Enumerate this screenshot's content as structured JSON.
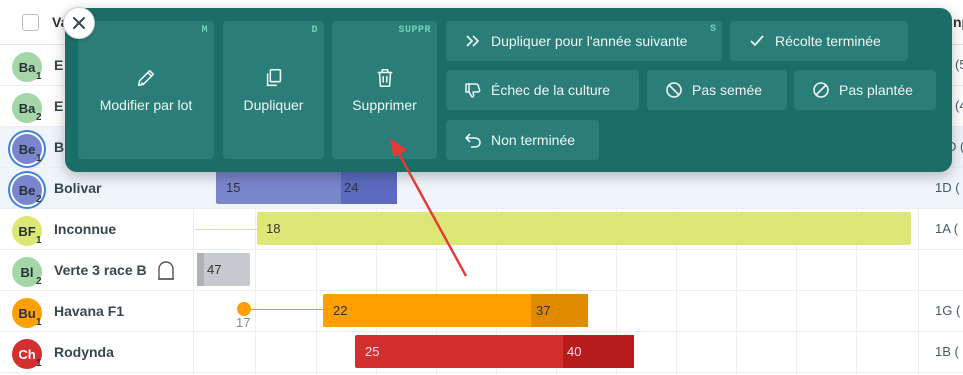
{
  "header": {
    "name_col_label": "Va",
    "right_col_label": "np"
  },
  "rows": [
    {
      "avatar": "Ba",
      "sub": "1",
      "name": "E",
      "color": "#a5d6a7",
      "right": "(5"
    },
    {
      "avatar": "Ba",
      "sub": "2",
      "name": "E",
      "color": "#a5d6a7",
      "right": "(4"
    },
    {
      "avatar": "Be",
      "sub": "1",
      "name": "B",
      "color": "#7986cb",
      "right": "D ("
    },
    {
      "avatar": "Be",
      "sub": "2",
      "name": "Bolivar",
      "color": "#7986cb",
      "right": "1D ("
    },
    {
      "avatar": "BF",
      "sub": "1",
      "name": "Inconnue",
      "color": "#dce775",
      "right": "1A ("
    },
    {
      "avatar": "Bl",
      "sub": "2",
      "name": "Verte 3 race B",
      "color": "#a5d6a7",
      "right": ""
    },
    {
      "avatar": "Bu",
      "sub": "1",
      "name": "Havana F1",
      "color": "#ffa000",
      "right": "1G ("
    },
    {
      "avatar": "Ch",
      "sub": "1",
      "name": "Rodynda",
      "color": "#d32f2f",
      "right": "1B ("
    }
  ],
  "bars": {
    "bolivar": [
      "15",
      "24"
    ],
    "inconnue": [
      "18"
    ],
    "verte": [
      "47"
    ],
    "havana": [
      "22",
      "37"
    ],
    "havana_marker": "17",
    "rodynda": [
      "25",
      "40"
    ]
  },
  "actions": {
    "close_label": "×",
    "edit_batch": {
      "label": "Modifier par lot",
      "hotkey": "M"
    },
    "duplicate": {
      "label": "Dupliquer",
      "hotkey": "D"
    },
    "delete": {
      "label": "Supprimer",
      "hotkey": "SUPPR"
    },
    "duplicate_next_year": {
      "label": "Dupliquer pour l'année suivante",
      "hotkey": "S"
    },
    "harvest_done": {
      "label": "Récolte terminée"
    },
    "crop_failure": {
      "label": "Échec de la culture"
    },
    "not_sown": {
      "label": "Pas semée"
    },
    "not_planted": {
      "label": "Pas plantée"
    },
    "not_finished": {
      "label": "Non terminée"
    }
  },
  "colors": {
    "panel": "#1b6d67",
    "button": "#2b7d77",
    "hotkey": "#6fd3b8",
    "arrow": "#e53935"
  }
}
